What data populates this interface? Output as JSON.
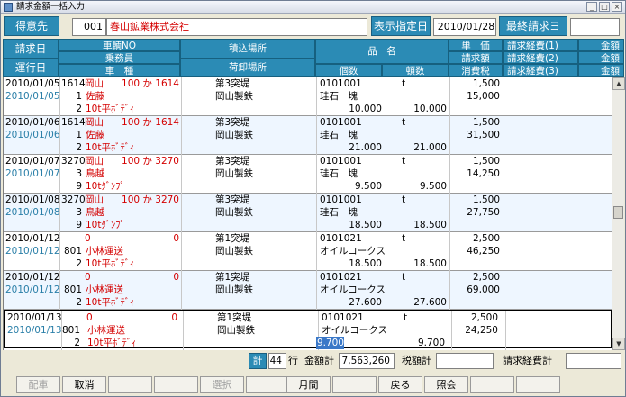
{
  "window": {
    "title": "請求金額一括入力",
    "min": "_",
    "max": "□",
    "close": "×"
  },
  "header": {
    "customer_label": "得意先",
    "customer_code": "001",
    "customer_name": "春山鉱業株式会社",
    "display_date_label": "表示指定日",
    "display_date": "2010/01/28",
    "last_invoice_label": "最終請求ヨ",
    "last_invoice_value": ""
  },
  "columns": {
    "billing_date": "請求日",
    "run_date": "運行日",
    "vehicle_no": "車輌NO",
    "driver": "乗務員",
    "vehicle_type": "車　種",
    "loading_place": "積込場所",
    "unloading_place": "荷卸場所",
    "product": "品　名",
    "quantity": "個数",
    "tonnage": "頓数",
    "unit_price": "単　価",
    "billing_amount": "請求額",
    "consumption_tax": "消費税",
    "expense1": "請求経費(1)",
    "expense2": "請求経費(2)",
    "expense3": "請求経費(3)",
    "amount1": "金額",
    "amount2": "金額",
    "amount3": "金額"
  },
  "rows": [
    {
      "bill_date": "2010/01/05",
      "run_date": "2010/01/05",
      "vehicle_code": "1614",
      "plate": "岡山",
      "plate_no": "100 か 1614",
      "driver_no": "1",
      "driver_name": "佐藤",
      "type_no": "2",
      "type_name": "10t平ﾎﾞﾃﾞｨ",
      "load": "第3突堤",
      "unload": "岡山製鉄",
      "prod_code": "0101001",
      "prod_unit": "t",
      "prod_name": "珪石　塊",
      "qty": "10.000",
      "ton": "10.000",
      "price": "1,500",
      "amount": "15,000",
      "tax": ""
    },
    {
      "bill_date": "2010/01/06",
      "run_date": "2010/01/06",
      "vehicle_code": "1614",
      "plate": "岡山",
      "plate_no": "100 か 1614",
      "driver_no": "1",
      "driver_name": "佐藤",
      "type_no": "2",
      "type_name": "10t平ﾎﾞﾃﾞｨ",
      "load": "第3突堤",
      "unload": "岡山製鉄",
      "prod_code": "0101001",
      "prod_unit": "t",
      "prod_name": "珪石　塊",
      "qty": "21.000",
      "ton": "21.000",
      "price": "1,500",
      "amount": "31,500",
      "tax": ""
    },
    {
      "bill_date": "2010/01/07",
      "run_date": "2010/01/07",
      "vehicle_code": "3270",
      "plate": "岡山",
      "plate_no": "100 か 3270",
      "driver_no": "3",
      "driver_name": "鳥越",
      "type_no": "9",
      "type_name": "10tﾀﾞﾝﾌﾟ",
      "load": "第3突堤",
      "unload": "岡山製鉄",
      "prod_code": "0101001",
      "prod_unit": "t",
      "prod_name": "珪石　塊",
      "qty": "9.500",
      "ton": "9.500",
      "price": "1,500",
      "amount": "14,250",
      "tax": ""
    },
    {
      "bill_date": "2010/01/08",
      "run_date": "2010/01/08",
      "vehicle_code": "3270",
      "plate": "岡山",
      "plate_no": "100 か 3270",
      "driver_no": "3",
      "driver_name": "鳥越",
      "type_no": "9",
      "type_name": "10tﾀﾞﾝﾌﾟ",
      "load": "第3突堤",
      "unload": "岡山製鉄",
      "prod_code": "0101001",
      "prod_unit": "t",
      "prod_name": "珪石　塊",
      "qty": "18.500",
      "ton": "18.500",
      "price": "1,500",
      "amount": "27,750",
      "tax": ""
    },
    {
      "bill_date": "2010/01/12",
      "run_date": "2010/01/12",
      "vehicle_code": "",
      "plate": "0",
      "plate_no": "0",
      "driver_no": "801",
      "driver_name": "小林運送",
      "type_no": "2",
      "type_name": "10t平ﾎﾞﾃﾞｨ",
      "load": "第1突堤",
      "unload": "岡山製鉄",
      "prod_code": "0101021",
      "prod_unit": "t",
      "prod_name": "オイルコークス",
      "qty": "18.500",
      "ton": "18.500",
      "price": "2,500",
      "amount": "46,250",
      "tax": ""
    },
    {
      "bill_date": "2010/01/12",
      "run_date": "2010/01/12",
      "vehicle_code": "",
      "plate": "0",
      "plate_no": "0",
      "driver_no": "801",
      "driver_name": "小林運送",
      "type_no": "2",
      "type_name": "10t平ﾎﾞﾃﾞｨ",
      "load": "第1突堤",
      "unload": "岡山製鉄",
      "prod_code": "0101021",
      "prod_unit": "t",
      "prod_name": "オイルコークス",
      "qty": "27.600",
      "ton": "27.600",
      "price": "2,500",
      "amount": "69,000",
      "tax": ""
    },
    {
      "bill_date": "2010/01/13",
      "run_date": "2010/01/13",
      "vehicle_code": "",
      "plate": "0",
      "plate_no": "0",
      "driver_no": "801",
      "driver_name": "小林運送",
      "type_no": "2",
      "type_name": "10t平ﾎﾞﾃﾞｨ",
      "load": "第1突堤",
      "unload": "岡山製鉄",
      "prod_code": "0101021",
      "prod_unit": "t",
      "prod_name": "オイルコークス",
      "qty": "9.700",
      "ton": "9.700",
      "price": "2,500",
      "amount": "24,250",
      "tax": ""
    }
  ],
  "totals": {
    "count_label": "計",
    "count_value": "44",
    "count_unit": "行",
    "amount_label": "金額計",
    "amount_value": "7,563,260",
    "tax_label": "税額計",
    "tax_value": "",
    "expense_label": "請求経費計",
    "expense_value": ""
  },
  "fkeys": [
    {
      "label": "配車",
      "enabled": false
    },
    {
      "label": "取消",
      "enabled": true
    },
    {
      "label": "",
      "enabled": true
    },
    {
      "label": "",
      "enabled": true
    },
    {
      "label": "選択",
      "enabled": false
    },
    {
      "label": "",
      "enabled": true
    },
    {
      "label": "月間",
      "enabled": true
    },
    {
      "label": "",
      "enabled": true
    },
    {
      "label": "戻る",
      "enabled": true
    },
    {
      "label": "照会",
      "enabled": true
    },
    {
      "label": "",
      "enabled": true
    },
    {
      "label": "",
      "enabled": true
    }
  ],
  "colors": {
    "header_blue": "#2b8bb5",
    "red_text": "#d40000",
    "cyan_text": "#2a7fa8"
  }
}
